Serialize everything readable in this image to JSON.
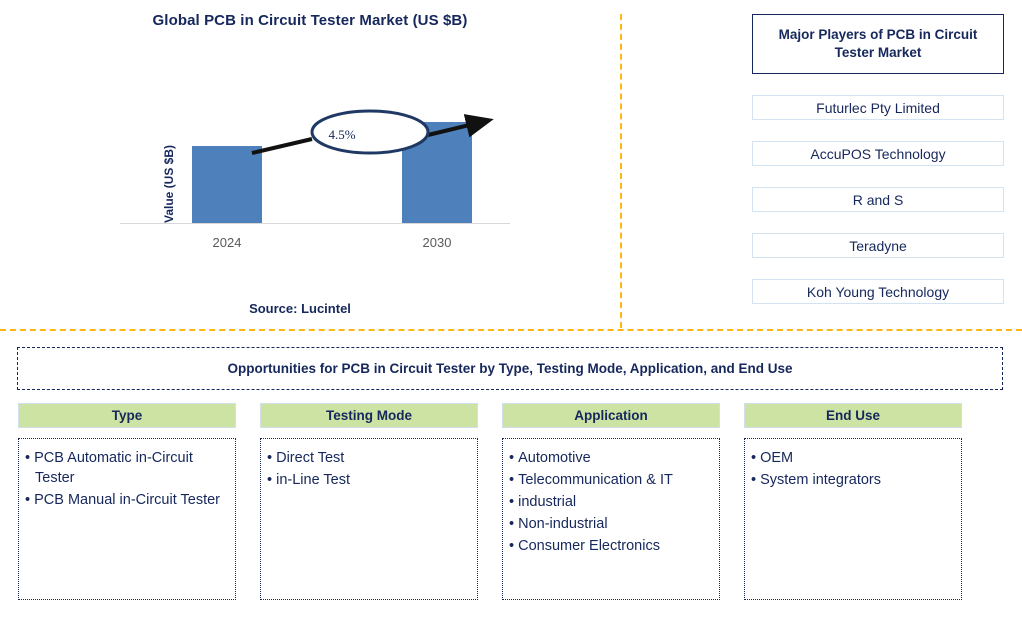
{
  "chart_panel": {
    "title": "Global PCB in Circuit Tester Market (US $B)",
    "y_axis_label": "Value (US $B)",
    "cagr_label": "4.5%",
    "source": "Source: Lucintel"
  },
  "chart_data": {
    "type": "bar",
    "title": "Global PCB in Circuit Tester Market (US $B)",
    "categories": [
      "2024",
      "2030"
    ],
    "values": [
      77,
      101
    ],
    "xlabel": "",
    "ylabel": "Value (US $B)",
    "ylim": [
      0,
      120
    ],
    "grid": false,
    "legend": "none",
    "annotations": [
      {
        "text": "4.5%",
        "type": "cagr-callout",
        "from": "2024",
        "to": "2030"
      }
    ],
    "series_color": "#4e81bc",
    "source": "Source: Lucintel"
  },
  "players": {
    "header": "Major Players of PCB in Circuit Tester Market",
    "items": [
      {
        "name": "Futurlec Pty Limited"
      },
      {
        "name": "AccuPOS Technology"
      },
      {
        "name": "R and S"
      },
      {
        "name": "Teradyne"
      },
      {
        "name": "Koh Young Technology"
      }
    ]
  },
  "opportunities": {
    "banner": "Opportunities for PCB in Circuit Tester by Type, Testing Mode, Application, and End Use",
    "columns": [
      {
        "header": "Type",
        "items": [
          "PCB Automatic in-Circuit Tester",
          "PCB Manual in-Circuit Tester"
        ]
      },
      {
        "header": "Testing Mode",
        "items": [
          "Direct Test",
          "in-Line Test"
        ]
      },
      {
        "header": "Application",
        "items": [
          "Automotive",
          "Telecommunication & IT",
          "industrial",
          "Non-industrial",
          "Consumer Electronics"
        ]
      },
      {
        "header": "End Use",
        "items": [
          "OEM",
          "System integrators"
        ]
      }
    ]
  },
  "colors": {
    "brand_navy": "#16275c",
    "bar_blue": "#4e81bc",
    "accent_orange": "#fcb712",
    "header_green": "#cde3a4"
  }
}
